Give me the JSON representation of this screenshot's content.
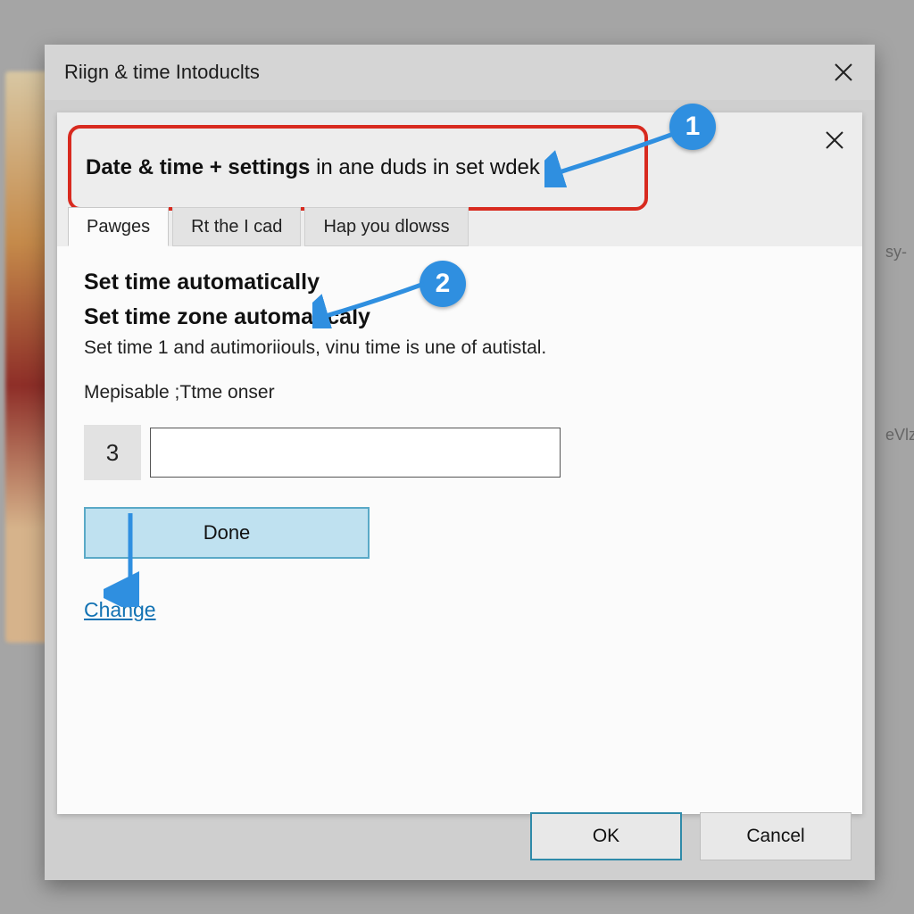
{
  "outer": {
    "title": "Riign & time Intoduclts"
  },
  "inner": {
    "heading_bold1": "Date & time + settings",
    "heading_rest": " in ane duds in set wdek",
    "tabs": [
      {
        "label": "Pawges"
      },
      {
        "label": "Rt the I cad"
      },
      {
        "label": "Hap you dlowss"
      }
    ],
    "line_auto_time": "Set time automatically",
    "line_auto_zone": "Set time zone automaticaly",
    "desc1": "Set time 1 and autimoriiouls, vinu time is une of autistal.",
    "desc2": "Mepisable ;Ttme onser",
    "step_number": "3",
    "input_value": "",
    "done_label": "Done",
    "change_label": "Change"
  },
  "footer": {
    "ok": "OK",
    "cancel": "Cancel"
  },
  "annotations": {
    "c1": "1",
    "c2": "2"
  },
  "background": {
    "frag1": "sy-",
    "frag2": "eVlz"
  },
  "colors": {
    "callout_blue": "#2f8fe0",
    "highlight_red": "#d82a1f",
    "done_btn_bg": "#bfe1f0",
    "done_btn_border": "#5aa9c7",
    "link_blue": "#1272b3"
  }
}
